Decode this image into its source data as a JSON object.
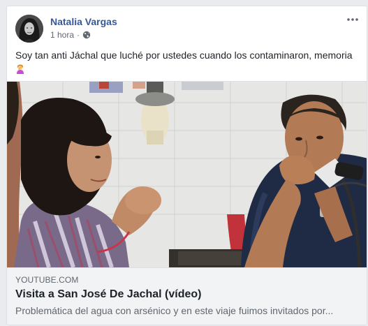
{
  "post": {
    "author": "Natalia Vargas",
    "time": "1 hora",
    "separator": "·",
    "privacy_icon": "globe-icon",
    "text": "Soy tan anti Jáchal que luché por ustedes cuando los contaminaron, memoria",
    "emoji_icon": "person-facepalming-emoji"
  },
  "link": {
    "domain": "YOUTUBE.COM",
    "title": "Visita a San José De Jachal (vídeo)",
    "description": "Problemática del agua con arsénico y en este viaje fuimos invitados por..."
  },
  "colors": {
    "author_link": "#365899",
    "page_bg": "#e9ebee",
    "caption_bg": "#f2f3f5"
  }
}
